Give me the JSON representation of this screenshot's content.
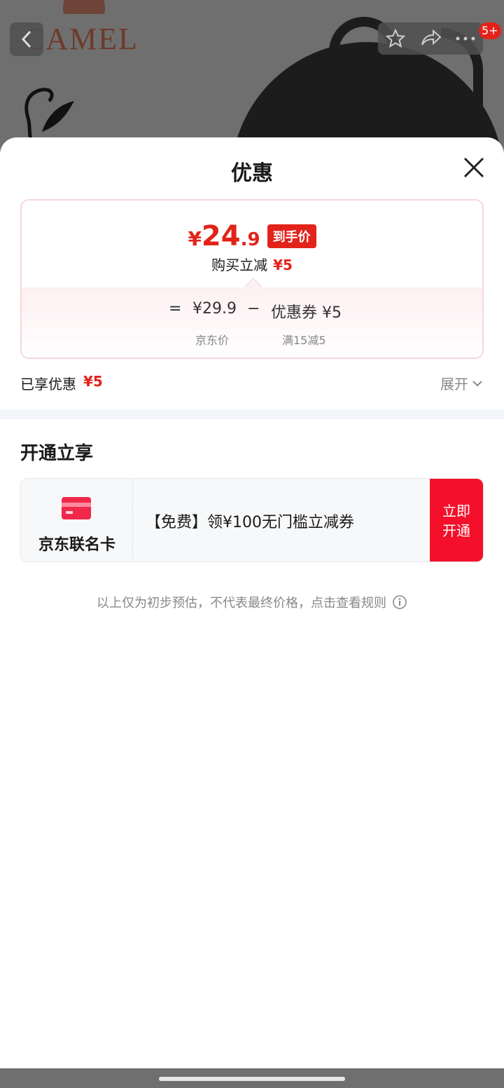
{
  "background": {
    "brand": "CAMEL",
    "cart_badge": "5+"
  },
  "sheet": {
    "title": "优惠",
    "price": {
      "currency": "¥",
      "int": "24",
      "dec": ".9",
      "tag": "到手价",
      "reduce_label": "购买立减",
      "reduce_value": "¥5",
      "equals": "=",
      "jd_price": "¥29.9",
      "minus": "−",
      "coupon": "优惠券 ¥5",
      "jd_price_label": "京东价",
      "coupon_label": "满15减5"
    },
    "enjoyed_label": "已享优惠",
    "enjoyed_value": "¥5",
    "expand_label": "展开",
    "section_title": "开通立享",
    "card": {
      "name": "京东联名卡",
      "desc": "【免费】领¥100无门槛立减券",
      "button": "立即开通"
    },
    "disclaimer": "以上仅为初步预估，不代表最终价格，点击查看规则"
  },
  "colors": {
    "accent": "#e2231a",
    "button": "#f4102a",
    "border": "#f7d6dc"
  }
}
